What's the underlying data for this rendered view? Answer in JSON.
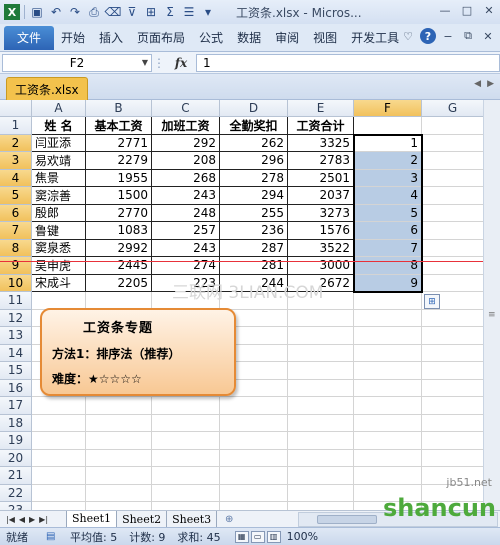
{
  "window": {
    "title": "工资条.xlsx - Micros...",
    "buttons": [
      "—",
      "□",
      "✕"
    ]
  },
  "ribbon": {
    "file_tab": "文件",
    "tabs": [
      "开始",
      "插入",
      "页面布局",
      "公式",
      "数据",
      "审阅",
      "视图",
      "开发工具"
    ]
  },
  "formula_bar": {
    "name_box": "F2",
    "fx_label": "fx",
    "value": "1"
  },
  "workbook": {
    "tab_label": "工资条.xlsx"
  },
  "grid": {
    "columns": [
      "A",
      "B",
      "C",
      "D",
      "E",
      "F",
      "G"
    ],
    "selected_column": "F",
    "row_numbers": [
      "1",
      "2",
      "3",
      "4",
      "5",
      "6",
      "7",
      "8",
      "9",
      "10",
      "11",
      "12",
      "13",
      "14",
      "15",
      "16",
      "17",
      "18",
      "19",
      "20",
      "21",
      "22",
      "23"
    ],
    "header_row": [
      "姓 名",
      "基本工资",
      "加班工资",
      "全勤奖扣",
      "工资合计"
    ],
    "rows": [
      [
        "闫亚添",
        "2771",
        "292",
        "262",
        "3325",
        "1"
      ],
      [
        "易欢靖",
        "2279",
        "208",
        "296",
        "2783",
        "2"
      ],
      [
        "焦景",
        "1955",
        "268",
        "278",
        "2501",
        "3"
      ],
      [
        "窦淙善",
        "1500",
        "243",
        "294",
        "2037",
        "4"
      ],
      [
        "殷郎",
        "2770",
        "248",
        "255",
        "3273",
        "5"
      ],
      [
        "鲁键",
        "1083",
        "257",
        "236",
        "1576",
        "6"
      ],
      [
        "窦泉悉",
        "2992",
        "243",
        "287",
        "3522",
        "7"
      ],
      [
        "吴申虎",
        "2445",
        "274",
        "281",
        "3000",
        "8"
      ],
      [
        "宋成斗",
        "2205",
        "223",
        "244",
        "2672",
        "9"
      ]
    ]
  },
  "watermark": "三联网 3LIAN.COM",
  "callout": {
    "title": "工资条专题",
    "method": "方法1：排序法（推荐）",
    "difficulty": "难度：★☆☆☆☆"
  },
  "sheets": {
    "tabs": [
      "Sheet1",
      "Sheet2",
      "Sheet3"
    ],
    "active": "Sheet1"
  },
  "status_bar": {
    "ready": "就绪",
    "average": "平均值: 5",
    "count": "计数: 9",
    "sum": "求和: 45",
    "zoom": "100%"
  },
  "branding": {
    "site": "jb51.net",
    "logo": "shancun"
  },
  "colors": {
    "file_tab": "#2d64b5",
    "workbook_tab": "#f3c24c",
    "selection_fill": "#b8cce4",
    "callout_border": "#e58a35",
    "red_line": "#e8313a"
  }
}
